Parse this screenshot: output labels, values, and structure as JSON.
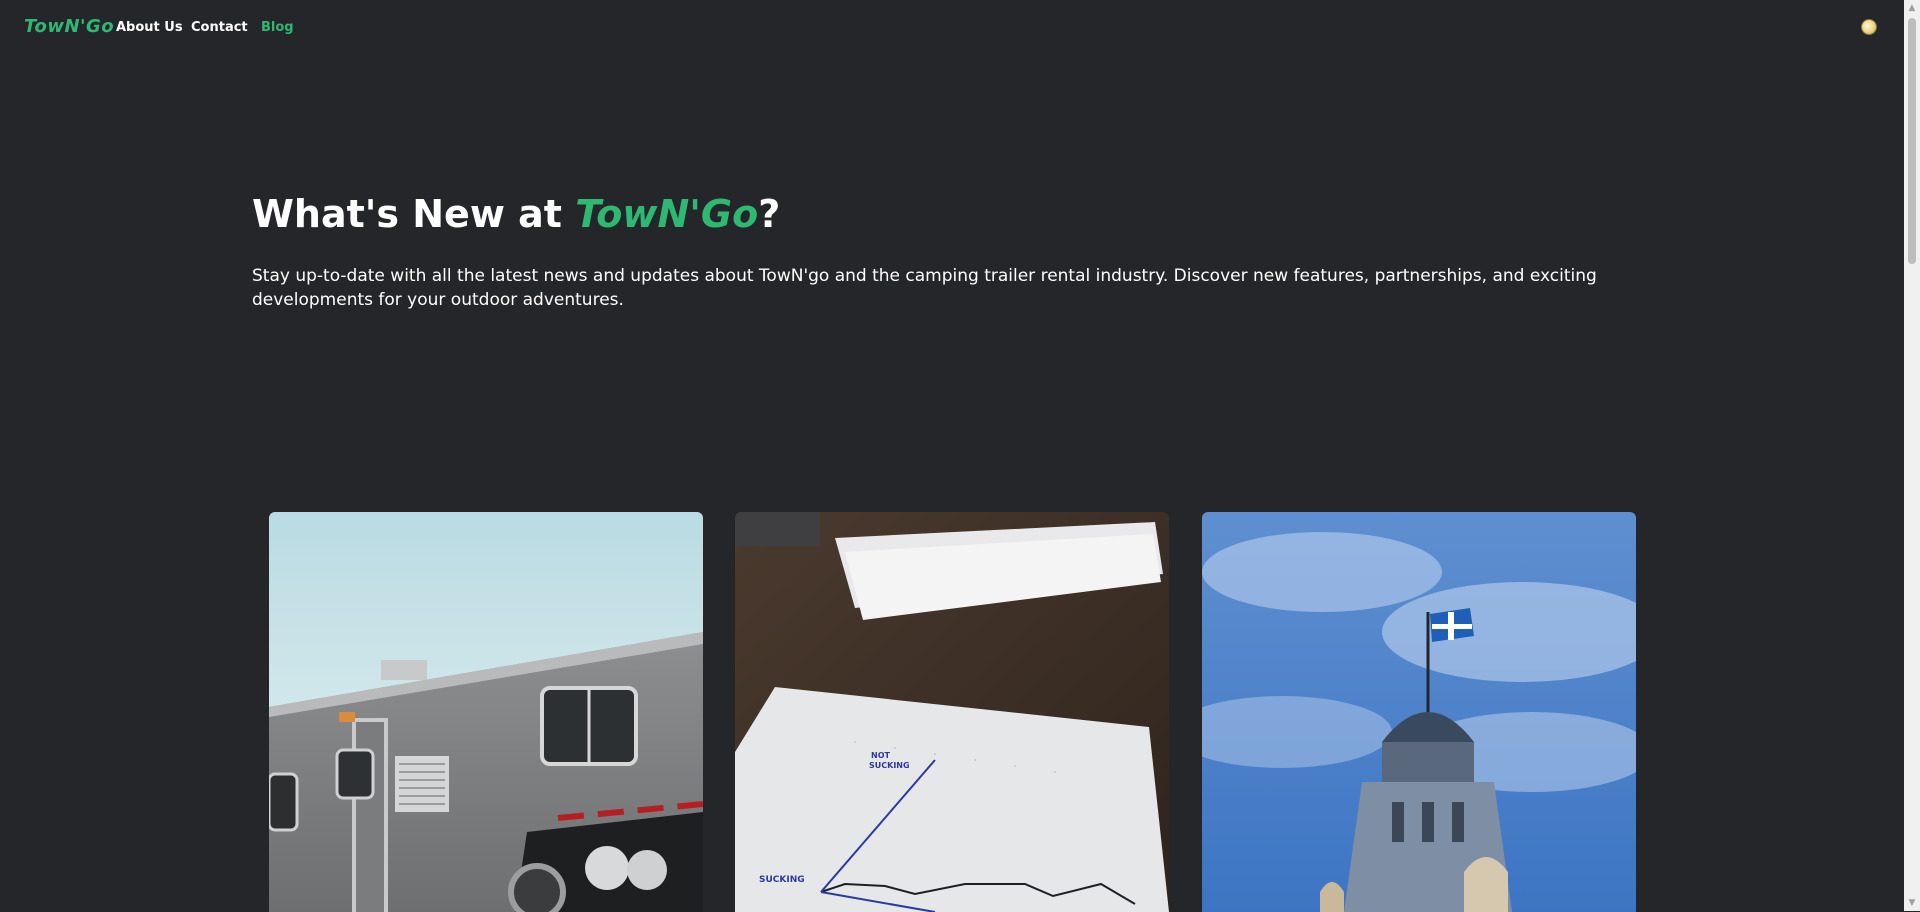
{
  "nav": {
    "logo": "TowN'Go",
    "links": [
      {
        "label": "About Us"
      },
      {
        "label": "Contact"
      },
      {
        "label": "Blog",
        "active": true
      }
    ]
  },
  "hero": {
    "title_prefix": "What's New at ",
    "title_brand": "TowN'Go",
    "title_suffix": "?",
    "subtitle": "Stay up-to-date with all the latest news and updates about TowN'go and the camping trailer rental industry. Discover new features, partnerships, and exciting developments for your outdoor adventures."
  },
  "cards": [
    {
      "image": "camping-trailer-photo"
    },
    {
      "image": "notebook-chart-photo",
      "sketch_labels": [
        "NOT SUCKING",
        "SUCKING"
      ]
    },
    {
      "image": "quebec-parliament-flag-photo"
    }
  ],
  "colors": {
    "background": "#25262a",
    "brand": "#2eb872",
    "text": "#ffffff"
  }
}
